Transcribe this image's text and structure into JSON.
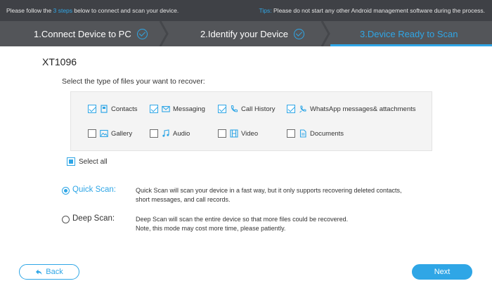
{
  "infobar": {
    "prefix": "Please follow the ",
    "highlight": "3 steps",
    "suffix": " below to connect and scan your device.",
    "tips_label": "Tips:",
    "tips_text": " Please do not start any other Android management software during the process."
  },
  "steps": [
    {
      "label": "1.Connect Device to PC",
      "done": true
    },
    {
      "label": "2.Identify your Device",
      "done": true
    },
    {
      "label": "3.Device Ready to Scan",
      "active": true
    }
  ],
  "device_name": "XT1096",
  "select_type_text": "Select the type of files your want to recover:",
  "file_types": [
    {
      "label": "Contacts",
      "checked": true,
      "icon": "contacts-icon"
    },
    {
      "label": "Messaging",
      "checked": true,
      "icon": "envelope-icon"
    },
    {
      "label": "Call History",
      "checked": true,
      "icon": "phone-icon"
    },
    {
      "label": "WhatsApp messages& attachments",
      "checked": true,
      "icon": "whatsapp-icon"
    },
    {
      "label": "Gallery",
      "checked": false,
      "icon": "image-icon"
    },
    {
      "label": "Audio",
      "checked": false,
      "icon": "music-icon"
    },
    {
      "label": "Video",
      "checked": false,
      "icon": "film-icon"
    },
    {
      "label": "Documents",
      "checked": false,
      "icon": "document-icon"
    }
  ],
  "select_all_label": "Select all",
  "scan_options": [
    {
      "label": "Quick Scan:",
      "selected": true,
      "desc1": "Quick Scan will scan your device in a fast way, but it only supports recovering deleted contacts,",
      "desc2": "short messages, and call records."
    },
    {
      "label": "Deep Scan:",
      "selected": false,
      "desc1": "Deep Scan will scan the entire device so that more files could be recovered.",
      "desc2": "Note, this mode may cost more time, please patiently."
    }
  ],
  "buttons": {
    "back": "Back",
    "next": "Next"
  },
  "colors": {
    "accent": "#2fa6e6",
    "topbar": "#3f4146",
    "stepbar": "#535559"
  }
}
